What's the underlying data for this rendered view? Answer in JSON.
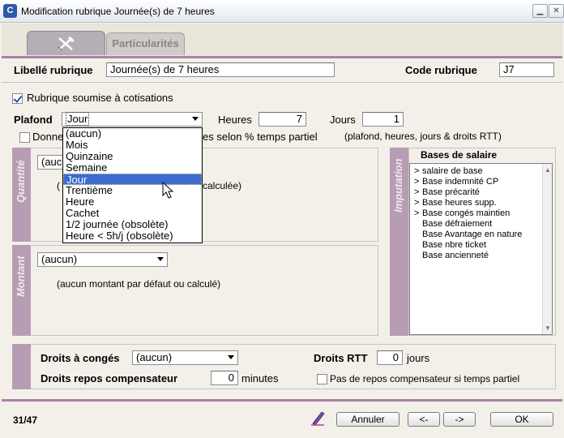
{
  "window": {
    "title": "Modification rubrique Journée(s) de 7 heures",
    "icon_letter": "C"
  },
  "tabs": {
    "particularites": "Particularités"
  },
  "header": {
    "libelle_label": "Libellé rubrique",
    "libelle_value": "Journée(s) de 7 heures",
    "code_label": "Code rubrique",
    "code_value": "J7"
  },
  "cotisations": {
    "label": "Rubrique soumise à cotisations",
    "checked": true
  },
  "plafond": {
    "label": "Plafond",
    "selected": "Jour",
    "options": [
      "(aucun)",
      "Mois",
      "Quinzaine",
      "Semaine",
      "Jour",
      "Trentième",
      "Heure",
      "Cachet",
      "1/2 journée (obsolète)",
      "Heure < 5h/j (obsolète)"
    ],
    "heures_label": "Heures",
    "heures_value": "7",
    "jours_label": "Jours",
    "jours_value": "1"
  },
  "temps_partiel": {
    "label_visible_start": "Donne",
    "label_visible_end": "es selon % temps partiel",
    "note": "(plafond, heures, jours & droits RTT)"
  },
  "quantite": {
    "side_label": "Quantité",
    "select_partial": "(auc",
    "desc_partial_start": "(",
    "desc_partial_end": "calculée)"
  },
  "montant": {
    "side_label": "Montant",
    "select_value": "(aucun)",
    "desc": "(aucun montant par défaut ou calculé)"
  },
  "imputation": {
    "side_label": "Imputation",
    "header": "Bases de salaire",
    "items": [
      {
        "marker": ">",
        "label": "salaire de base"
      },
      {
        "marker": ">",
        "label": "Base indemnité CP"
      },
      {
        "marker": ">",
        "label": "Base précarité"
      },
      {
        "marker": ">",
        "label": "Base heures supp."
      },
      {
        "marker": ">",
        "label": "Base congés maintien"
      },
      {
        "marker": "",
        "label": "Base défraiement"
      },
      {
        "marker": "",
        "label": "Base Avantage en nature"
      },
      {
        "marker": "",
        "label": "Base nbre ticket"
      },
      {
        "marker": "",
        "label": "Base ancienneté"
      }
    ]
  },
  "droits": {
    "conges_label": "Droits à congés",
    "conges_value": "(aucun)",
    "rtt_label": "Droits RTT",
    "rtt_value": "0",
    "rtt_unit": "jours",
    "repos_label": "Droits repos compensateur",
    "repos_value": "0",
    "repos_unit": "minutes",
    "repos_tp_label": "Pas de repos compensateur si temps partiel"
  },
  "footer": {
    "counter": "31/47",
    "annuler": "Annuler",
    "prev": "<-",
    "next": "->",
    "ok": "OK"
  }
}
